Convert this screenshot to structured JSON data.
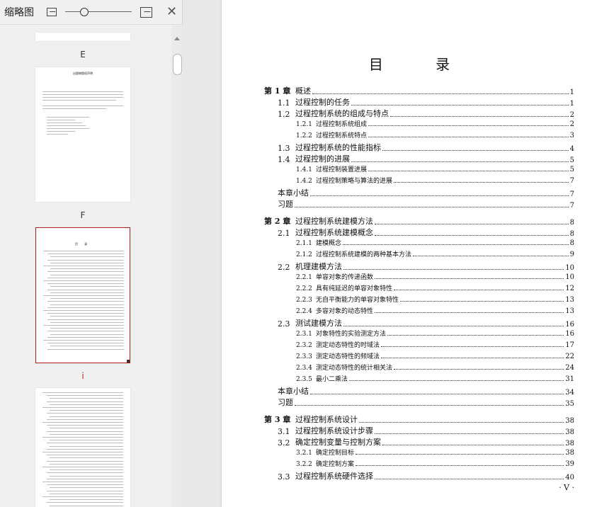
{
  "pane": {
    "title": "缩略图"
  },
  "thumbnails": [
    {
      "label": "E",
      "selected": false
    },
    {
      "label": "F",
      "selected": false
    },
    {
      "label": "i",
      "selected": true
    },
    {
      "label": "",
      "selected": false
    }
  ],
  "thumb_text": {
    "declaration_title": "出版物版权声明"
  },
  "toc": {
    "title": "目  录",
    "entries": [
      {
        "level": 1,
        "num": "第 1 章",
        "text": "概述",
        "page": "1"
      },
      {
        "level": 2,
        "num": "1.1",
        "text": "过程控制的任务",
        "page": "1"
      },
      {
        "level": 2,
        "num": "1.2",
        "text": "过程控制系统的组成与特点",
        "page": "2"
      },
      {
        "level": 3,
        "num": "1.2.1",
        "text": "过程控制系统组成",
        "page": "2"
      },
      {
        "level": 3,
        "num": "1.2.2",
        "text": "过程控制系统特点",
        "page": "3"
      },
      {
        "level": 2,
        "num": "1.3",
        "text": "过程控制系统的性能指标",
        "page": "4"
      },
      {
        "level": 2,
        "num": "1.4",
        "text": "过程控制的进展",
        "page": "5"
      },
      {
        "level": 3,
        "num": "1.4.1",
        "text": "过程控制装置进展",
        "page": "5"
      },
      {
        "level": 3,
        "num": "1.4.2",
        "text": "过程控制策略与算法的进展",
        "page": "7"
      },
      {
        "level": 2,
        "num": "",
        "text": "本章小结",
        "page": "7"
      },
      {
        "level": 2,
        "num": "",
        "text": "习题",
        "page": "7"
      },
      {
        "level": 1,
        "num": "第 2 章",
        "text": "过程控制系统建模方法",
        "page": "8"
      },
      {
        "level": 2,
        "num": "2.1",
        "text": "过程控制系统建模概念",
        "page": "8"
      },
      {
        "level": 3,
        "num": "2.1.1",
        "text": "建模概念",
        "page": "8"
      },
      {
        "level": 3,
        "num": "2.1.2",
        "text": "过程控制系统建模的两种基本方法",
        "page": "9"
      },
      {
        "level": 2,
        "num": "2.2",
        "text": "机理建模方法",
        "page": "10"
      },
      {
        "level": 3,
        "num": "2.2.1",
        "text": "单容对象的传递函数",
        "page": "10"
      },
      {
        "level": 3,
        "num": "2.2.2",
        "text": "具有纯延迟的单容对象特性",
        "page": "12"
      },
      {
        "level": 3,
        "num": "2.2.3",
        "text": "无自平衡能力的单容对象特性",
        "page": "13"
      },
      {
        "level": 3,
        "num": "2.2.4",
        "text": "多容对象的动态特性",
        "page": "13"
      },
      {
        "level": 2,
        "num": "2.3",
        "text": "测试建模方法",
        "page": "16"
      },
      {
        "level": 3,
        "num": "2.3.1",
        "text": "对象特性的实验测定方法",
        "page": "16"
      },
      {
        "level": 3,
        "num": "2.3.2",
        "text": "测定动态特性的时域法",
        "page": "17"
      },
      {
        "level": 3,
        "num": "2.3.3",
        "text": "测定动态特性的频域法",
        "page": "22"
      },
      {
        "level": 3,
        "num": "2.3.4",
        "text": "测定动态特性的统计相关法",
        "page": "24"
      },
      {
        "level": 3,
        "num": "2.3.5",
        "text": "最小二乘法",
        "page": "31"
      },
      {
        "level": 2,
        "num": "",
        "text": "本章小结",
        "page": "34"
      },
      {
        "level": 2,
        "num": "",
        "text": "习题",
        "page": "35"
      },
      {
        "level": 1,
        "num": "第 3 章",
        "text": "过程控制系统设计",
        "page": "38"
      },
      {
        "level": 2,
        "num": "3.1",
        "text": "过程控制系统设计步骤",
        "page": "38"
      },
      {
        "level": 2,
        "num": "3.2",
        "text": "确定控制变量与控制方案",
        "page": "38"
      },
      {
        "level": 3,
        "num": "3.2.1",
        "text": "确定控制目标",
        "page": "38"
      },
      {
        "level": 3,
        "num": "3.2.2",
        "text": "确定控制方案",
        "page": "39"
      },
      {
        "level": 2,
        "num": "3.3",
        "text": "过程控制系统硬件选择",
        "page": "40"
      }
    ]
  },
  "footer": {
    "page_number": "· V ·"
  }
}
